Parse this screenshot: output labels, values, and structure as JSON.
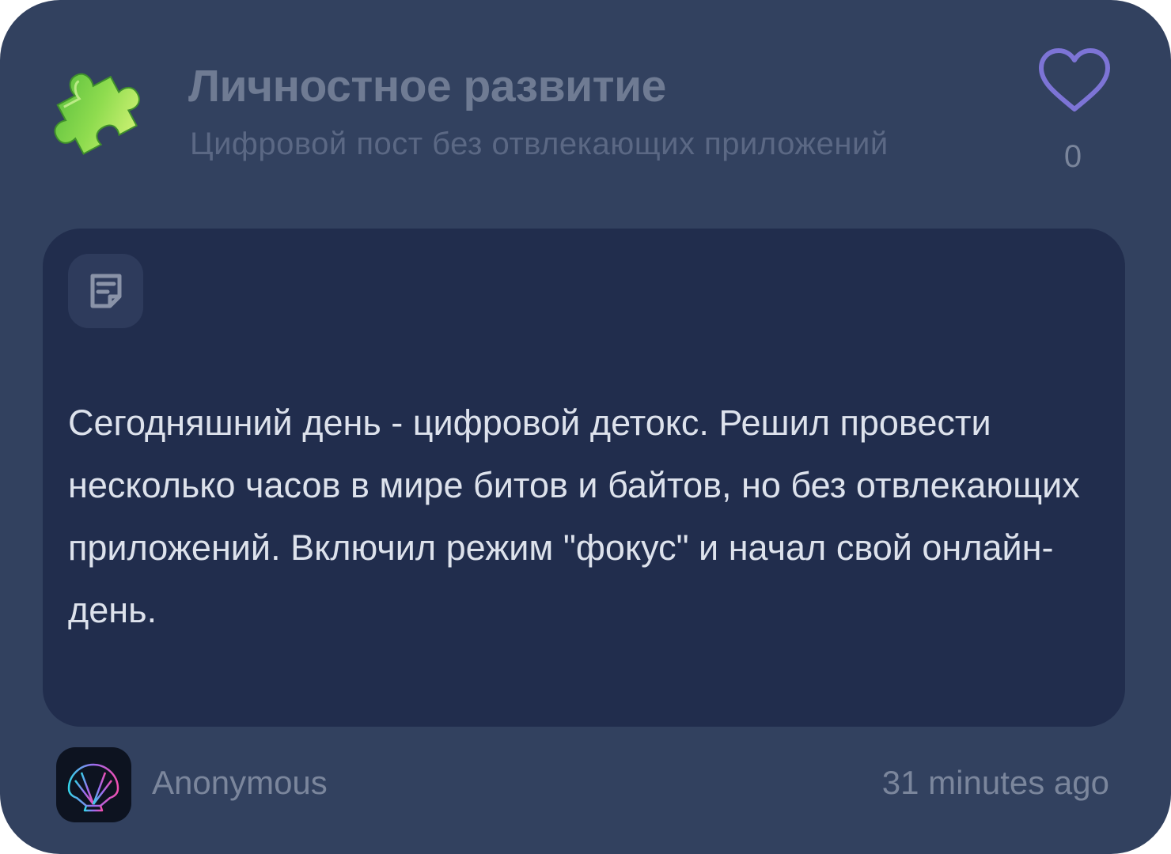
{
  "post": {
    "category_title": "Личностное развитие",
    "subtitle": "Цифровой пост без отвлекающих приложений",
    "likes": "0",
    "body": "Сегодняшний день - цифровой детокс. Решил провести несколько часов в мире битов и байтов, но без отвлекающих приложений. Включил режим \"фокус\" и начал свой онлайн-день.",
    "author": "Anonymous",
    "timestamp": "31 minutes ago"
  },
  "icons": {
    "category": "puzzle-piece-icon",
    "like": "heart-icon",
    "note": "note-icon",
    "avatar": "seashell-icon"
  },
  "colors": {
    "card_background": "#32415f",
    "content_background": "#212d4d",
    "heart_stroke": "#7d74d6",
    "puzzle_green": "#8ee04a"
  }
}
